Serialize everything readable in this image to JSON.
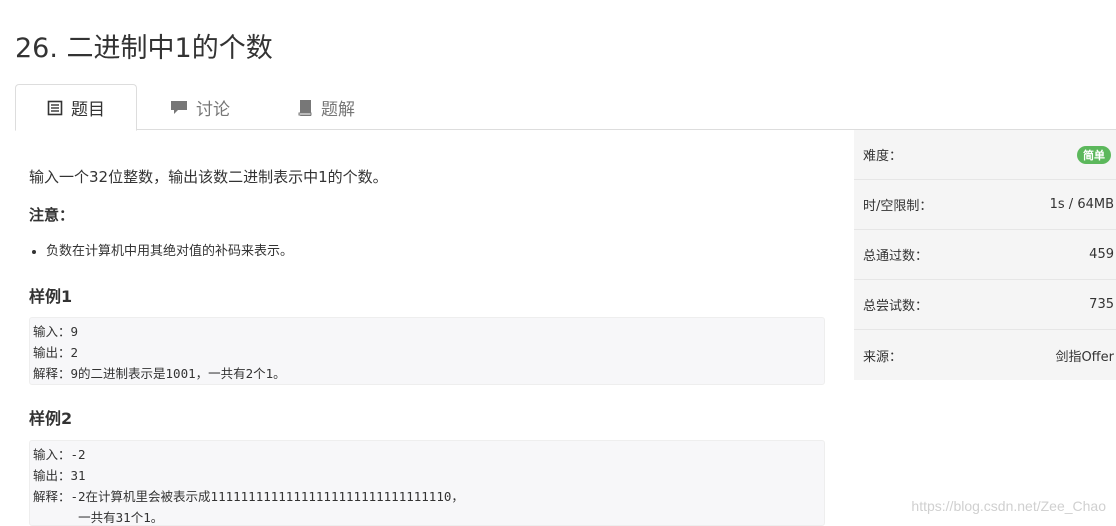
{
  "problem": {
    "title": "26. 二进制中1的个数"
  },
  "tabs": [
    {
      "label": "题目",
      "icon": "list-icon"
    },
    {
      "label": "讨论",
      "icon": "comment-icon"
    },
    {
      "label": "题解",
      "icon": "book-icon"
    }
  ],
  "description": "输入一个32位整数，输出该数二进制表示中1的个数。",
  "note": {
    "title": "注意：",
    "items": [
      "负数在计算机中用其绝对值的补码来表示。"
    ]
  },
  "samples": [
    {
      "title": "样例1",
      "lines": [
        "输入：9",
        "输出：2",
        "解释：9的二进制表示是1001，一共有2个1。"
      ]
    },
    {
      "title": "样例2",
      "lines": [
        "输入：-2",
        "输出：31",
        "解释：-2在计算机里会被表示成11111111111111111111111111111110，",
        "      一共有31个1。"
      ]
    }
  ],
  "sidebar": {
    "rows": [
      {
        "label": "难度：",
        "value": "简单",
        "badge_color": "#5cb85c"
      },
      {
        "label": "时/空限制：",
        "value": "1s / 64MB"
      },
      {
        "label": "总通过数：",
        "value": "459"
      },
      {
        "label": "总尝试数：",
        "value": "735"
      },
      {
        "label": "来源：",
        "value": "剑指Offer"
      }
    ]
  },
  "watermark": "https://blog.csdn.net/Zee_Chao"
}
